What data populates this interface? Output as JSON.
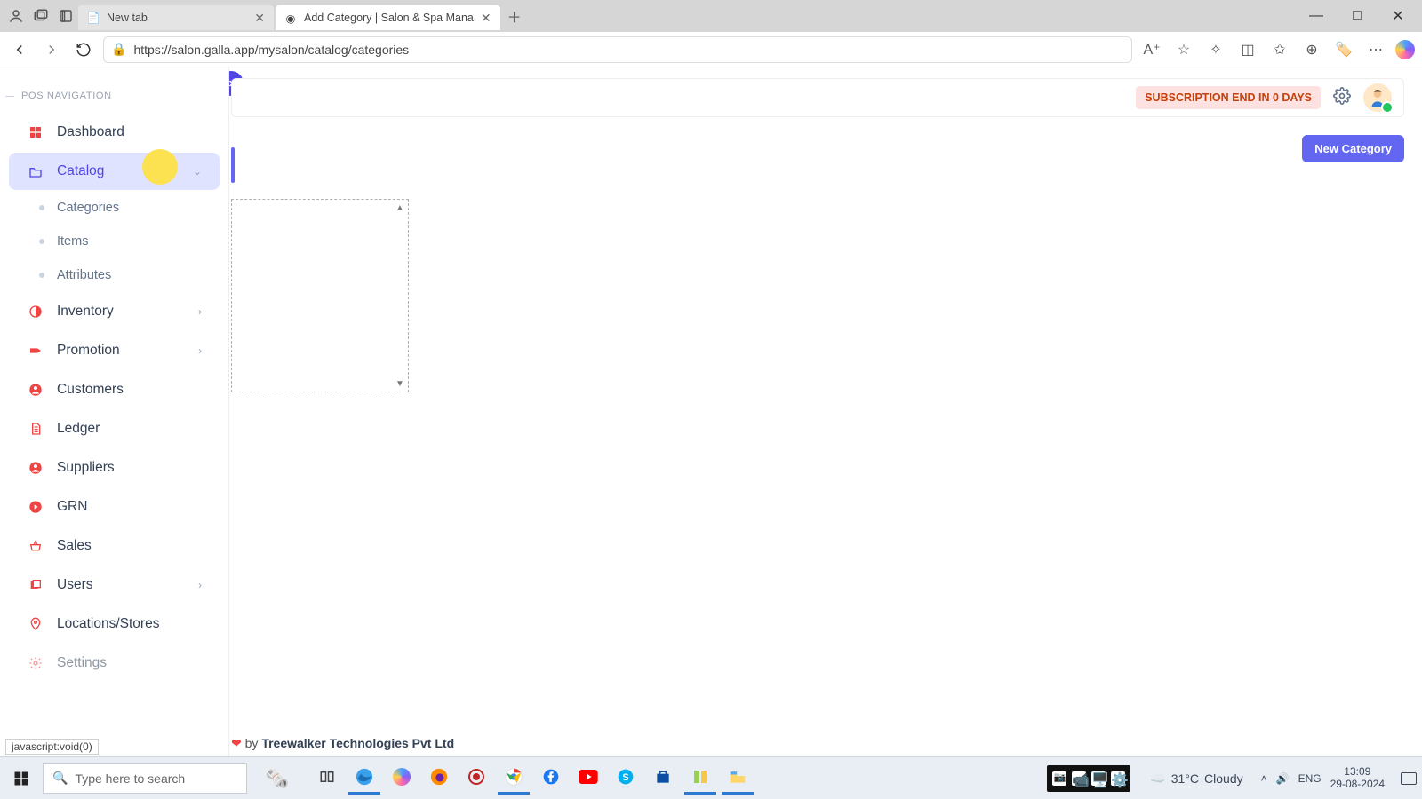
{
  "browser": {
    "tabs": [
      {
        "title": "New tab",
        "active": false,
        "favicon": "doc-icon"
      },
      {
        "title": "Add Category | Salon & Spa Mana",
        "active": true,
        "favicon": "circle-g-icon"
      }
    ],
    "url": "https://salon.galla.app/mysalon/catalog/categories",
    "status_text": "javascript:void(0)"
  },
  "app": {
    "nav_heading": "POS NAVIGATION",
    "subscription_chip": "SUBSCRIPTION END IN 0 DAYS",
    "new_button": "New Category",
    "sidebar": [
      {
        "label": "Dashboard",
        "icon": "grid-icon",
        "expandable": false
      },
      {
        "label": "Catalog",
        "icon": "folder-icon",
        "expandable": true,
        "active": true,
        "children": [
          {
            "label": "Categories"
          },
          {
            "label": "Items"
          },
          {
            "label": "Attributes"
          }
        ]
      },
      {
        "label": "Inventory",
        "icon": "contrast-icon",
        "expandable": true
      },
      {
        "label": "Promotion",
        "icon": "tag-icon",
        "expandable": true
      },
      {
        "label": "Customers",
        "icon": "user-circle-icon",
        "expandable": false
      },
      {
        "label": "Ledger",
        "icon": "file-icon",
        "expandable": false
      },
      {
        "label": "Suppliers",
        "icon": "user-circle-icon",
        "expandable": false
      },
      {
        "label": "GRN",
        "icon": "arrow-circle-icon",
        "expandable": false
      },
      {
        "label": "Sales",
        "icon": "basket-icon",
        "expandable": false
      },
      {
        "label": "Users",
        "icon": "layers-icon",
        "expandable": true
      },
      {
        "label": "Locations/Stores",
        "icon": "pin-icon",
        "expandable": false
      },
      {
        "label": "Settings",
        "icon": "gear-icon",
        "expandable": false
      }
    ],
    "footer_by": "by",
    "footer_company": "Treewalker Technologies Pvt Ltd"
  },
  "taskbar": {
    "search_placeholder": "Type here to search",
    "weather_temp": "31°C",
    "weather_cond": "Cloudy",
    "lang": "ENG",
    "time": "13:09",
    "date": "29-08-2024"
  }
}
